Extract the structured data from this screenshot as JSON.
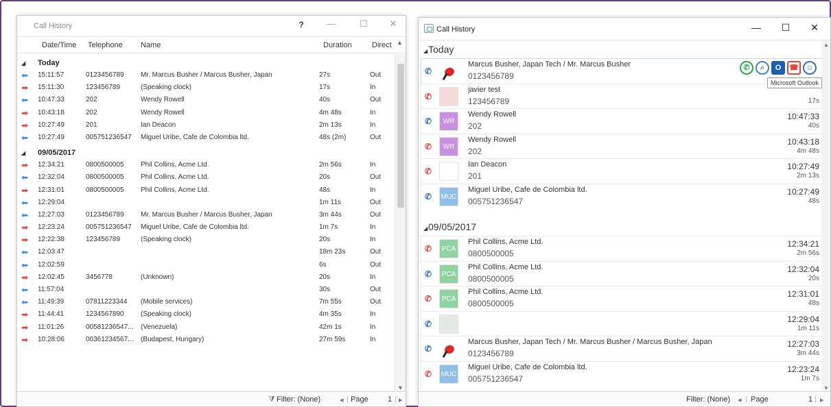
{
  "left": {
    "title": "Call History",
    "controls": {
      "help": "?",
      "minimize": "—",
      "maximize": "☐",
      "close": "✕"
    },
    "columns": {
      "datetime": "Date/Time",
      "telephone": "Telephone",
      "name": "Name",
      "duration": "Duration",
      "direction": "Direct"
    },
    "groups": [
      {
        "label": "Today",
        "rows": [
          {
            "dir_icon": "out",
            "time": "15:11:57",
            "tel": "0123456789",
            "name": "Mr. Marcus Busher / Marcus Busher, Japan",
            "dur": "27s",
            "dir": "Out"
          },
          {
            "dir_icon": "in",
            "time": "15:11:30",
            "tel": "123456789",
            "name": "(Speaking clock)",
            "dur": "17s",
            "dir": "In"
          },
          {
            "dir_icon": "out",
            "time": "10:47:33",
            "tel": "202",
            "name": "Wendy Rowell",
            "dur": "40s",
            "dir": "Out"
          },
          {
            "dir_icon": "in",
            "time": "10:43:18",
            "tel": "202",
            "name": "Wendy Rowell",
            "dur": "4m 48s",
            "dir": "In"
          },
          {
            "dir_icon": "in",
            "time": "10:27:49",
            "tel": "201",
            "name": "Ian Deacon",
            "dur": "2m 13s",
            "dir": "In"
          },
          {
            "dir_icon": "out",
            "time": "10:27:49",
            "tel": "005751236547",
            "name": "Miguel Uribe, Cafe de Colombia ltd.",
            "dur": "48s (2m)",
            "dir": "Out"
          }
        ]
      },
      {
        "label": "09/05/2017",
        "rows": [
          {
            "dir_icon": "in",
            "time": "12:34:21",
            "tel": "0800500005",
            "name": "Phil Collins, Acme Ltd.",
            "dur": "2m 56s",
            "dir": "In"
          },
          {
            "dir_icon": "out",
            "time": "12:32:04",
            "tel": "0800500005",
            "name": "Phil Collins, Acme Ltd.",
            "dur": "20s",
            "dir": "Out"
          },
          {
            "dir_icon": "in",
            "time": "12:31:01",
            "tel": "0800500005",
            "name": "Phil Collins, Acme Ltd.",
            "dur": "48s",
            "dir": "In"
          },
          {
            "dir_icon": "out",
            "time": "12:29:04",
            "tel": "",
            "name": "",
            "dur": "1m 11s",
            "dir": "Out"
          },
          {
            "dir_icon": "out",
            "time": "12:27:03",
            "tel": "0123456789",
            "name": "Mr. Marcus Busher / Marcus Busher, Japan",
            "dur": "3m 44s",
            "dir": "Out"
          },
          {
            "dir_icon": "in",
            "time": "12:23:24",
            "tel": "005751236547",
            "name": "Miguel Uribe, Cafe de Colombia ltd.",
            "dur": "1m 7s",
            "dir": "In"
          },
          {
            "dir_icon": "in",
            "time": "12:22:38",
            "tel": "123456789",
            "name": "(Speaking clock)",
            "dur": "20s",
            "dir": "In"
          },
          {
            "dir_icon": "out",
            "time": "12:03:47",
            "tel": "",
            "name": "",
            "dur": "18m 23s",
            "dir": "Out"
          },
          {
            "dir_icon": "out",
            "time": "12:02:59",
            "tel": "",
            "name": "",
            "dur": "6s",
            "dir": "Out"
          },
          {
            "dir_icon": "in",
            "time": "12:02:45",
            "tel": "3456778",
            "name": "(Unknown)",
            "dur": "20s",
            "dir": "In"
          },
          {
            "dir_icon": "out",
            "time": "11:57:04",
            "tel": "",
            "name": "",
            "dur": "30s",
            "dir": "Out"
          },
          {
            "dir_icon": "out",
            "time": "11:49:39",
            "tel": "07811223344",
            "name": "(Mobile services)",
            "dur": "7m 55s",
            "dir": "Out"
          },
          {
            "dir_icon": "in",
            "time": "11:44:41",
            "tel": "1234567890",
            "name": "(Speaking clock)",
            "dur": "4m 35s",
            "dir": "In"
          },
          {
            "dir_icon": "in",
            "time": "11:01:26",
            "tel": "00581236547...",
            "name": "(Venezuela)",
            "dur": "42m 1s",
            "dir": "In"
          },
          {
            "dir_icon": "in",
            "time": "10:28:06",
            "tel": "00361234567...",
            "name": "(Budapest, Hungary)",
            "dur": "27m 59s",
            "dir": "In"
          }
        ]
      }
    ],
    "footer": {
      "filter": "Filter: (None)",
      "page_label": "Page",
      "page_num": "1"
    }
  },
  "right": {
    "title": "Call History",
    "controls": {
      "minimize": "—",
      "maximize": "☐",
      "close": "✕"
    },
    "tooltip": "Microsoft Outlook",
    "groups": [
      {
        "label": "Today",
        "cards": [
          {
            "dir": "out",
            "avatar": "logo",
            "initials": "",
            "name": "Marcus Busher, Japan Tech / Mr. Marcus Busher",
            "number": "0123456789",
            "time": "",
            "sub": "",
            "actions": true
          },
          {
            "dir": "in",
            "avatar": "pinkish",
            "initials": "",
            "name": "javier test",
            "number": "123456789",
            "time": "",
            "sub": "17s"
          },
          {
            "dir": "out",
            "avatar": "wr",
            "initials": "WR",
            "name": "Wendy Rowell",
            "number": "202",
            "time": "10:47:33",
            "sub": "40s"
          },
          {
            "dir": "in",
            "avatar": "wr",
            "initials": "WR",
            "name": "Wendy Rowell",
            "number": "202",
            "time": "10:43:18",
            "sub": "4m 48s"
          },
          {
            "dir": "in",
            "avatar": "blank",
            "initials": "",
            "name": "Ian Deacon",
            "number": "201",
            "time": "10:27:49",
            "sub": "2m 13s"
          },
          {
            "dir": "out",
            "avatar": "muc",
            "initials": "MUC",
            "name": "Miguel Uribe, Cafe de Colombia ltd.",
            "number": "005751236547",
            "time": "10:27:49",
            "sub": "48s"
          }
        ]
      },
      {
        "label": "09/05/2017",
        "cards": [
          {
            "dir": "in",
            "avatar": "pca",
            "initials": "PCA",
            "name": "Phil Collins, Acme Ltd.",
            "number": "0800500005",
            "time": "12:34:21",
            "sub": "2m 56s"
          },
          {
            "dir": "out",
            "avatar": "pca",
            "initials": "PCA",
            "name": "Phil Collins, Acme Ltd.",
            "number": "0800500005",
            "time": "12:32:04",
            "sub": "20s"
          },
          {
            "dir": "in",
            "avatar": "pca",
            "initials": "PCA",
            "name": "Phil Collins, Acme Ltd.",
            "number": "0800500005",
            "time": "12:31:01",
            "sub": "48s"
          },
          {
            "dir": "out",
            "avatar": "grey",
            "initials": "",
            "name": "",
            "number": "",
            "time": "12:29:04",
            "sub": "1m 11s"
          },
          {
            "dir": "out",
            "avatar": "logo",
            "initials": "",
            "name": "Marcus Busher, Japan Tech / Mr. Marcus Busher / Marcus Busher, Japan",
            "number": "0123456789",
            "time": "12:27:03",
            "sub": "3m 44s"
          },
          {
            "dir": "in",
            "avatar": "muc",
            "initials": "MUC",
            "name": "Miguel Uribe, Cafe de Colombia ltd.",
            "number": "005751236547",
            "time": "12:23:24",
            "sub": "1m 7s"
          }
        ]
      }
    ],
    "footer": {
      "filter": "Filter: (None)",
      "page_label": "Page",
      "page_num": "1"
    }
  },
  "colors": {
    "in_arrow": "#e0443d",
    "out_arrow": "#3a8dde",
    "frame": "#6b3a7a"
  },
  "icons": {
    "in_call": "arrow-right-icon",
    "out_call": "arrow-left-icon",
    "phone": "phone-icon"
  }
}
